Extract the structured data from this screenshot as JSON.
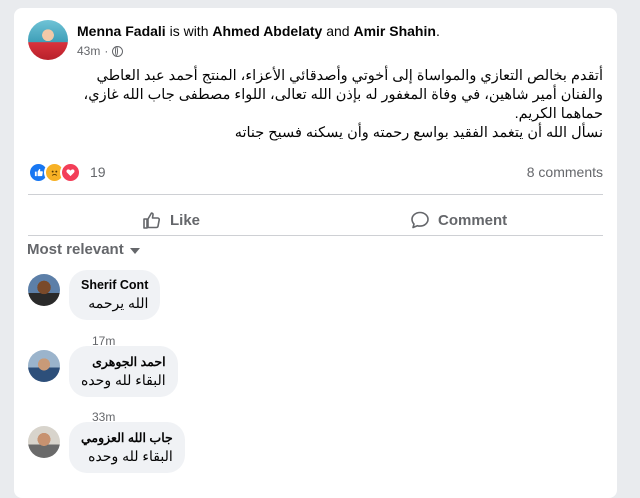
{
  "post": {
    "author": "Menna Fadali",
    "connector": " is with ",
    "tagged1": "Ahmed Abdelaty",
    "and": " and ",
    "tagged2": "Amir Shahin",
    "period": ".",
    "time": "43m",
    "audience_icon": "globe-icon",
    "text_line1": "أتقدم بخالص التعازي والمواساة إلى أخوتي وأصدقائي الأعزاء، المنتج أحمد عبد العاطي",
    "text_line2": "والفنان أمير شاهين، في وفاة المغفور له بإذن الله تعالى، اللواء مصطفى جاب الله غازي،",
    "text_line3": "حماهما الكريم.",
    "text_line4": "نسأل الله أن يتغمد الفقيد بواسع رحمته وأن يسكنه فسيح جناته"
  },
  "reactions": {
    "count": "19",
    "comments": "8 comments",
    "icons": [
      "like-reaction",
      "sad-reaction",
      "love-reaction"
    ],
    "colors": {
      "like": "#1877f2",
      "sad": "#f7b125",
      "love": "#f33e58"
    }
  },
  "actions": {
    "like": "Like",
    "comment": "Comment"
  },
  "sort": {
    "label": "Most relevant"
  },
  "comments": [
    {
      "name": "Sherif Cont",
      "text": "الله يرحمه",
      "time": "17m"
    },
    {
      "name": "احمد الجوهرى",
      "text": "البقاء لله وحده",
      "time": "33m"
    },
    {
      "name": "جاب الله العزومي",
      "text": "البقاء لله وحده",
      "time": ""
    }
  ]
}
